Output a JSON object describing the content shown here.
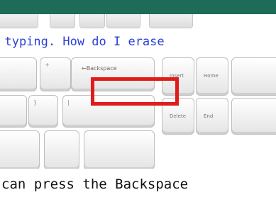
{
  "lesson": {
    "question": "e typing. How do I erase",
    "answer": "can press the Backspace"
  },
  "keyboard": {
    "top_keys": [
      "",
      "",
      "",
      "",
      ""
    ],
    "backspace_label": "←Backspace",
    "insert_label": "Insert",
    "home_label": "Home",
    "delete_label": "Delete",
    "end_label": "End",
    "plus_label": "+",
    "equals_label": "=",
    "pipe_label": "|",
    "bracket_label": "}",
    "bracket2_label": "]"
  },
  "colors": {
    "top_bar": "#1e6b57",
    "question_text": "#2a3fd6",
    "highlight": "#e11b1b"
  }
}
